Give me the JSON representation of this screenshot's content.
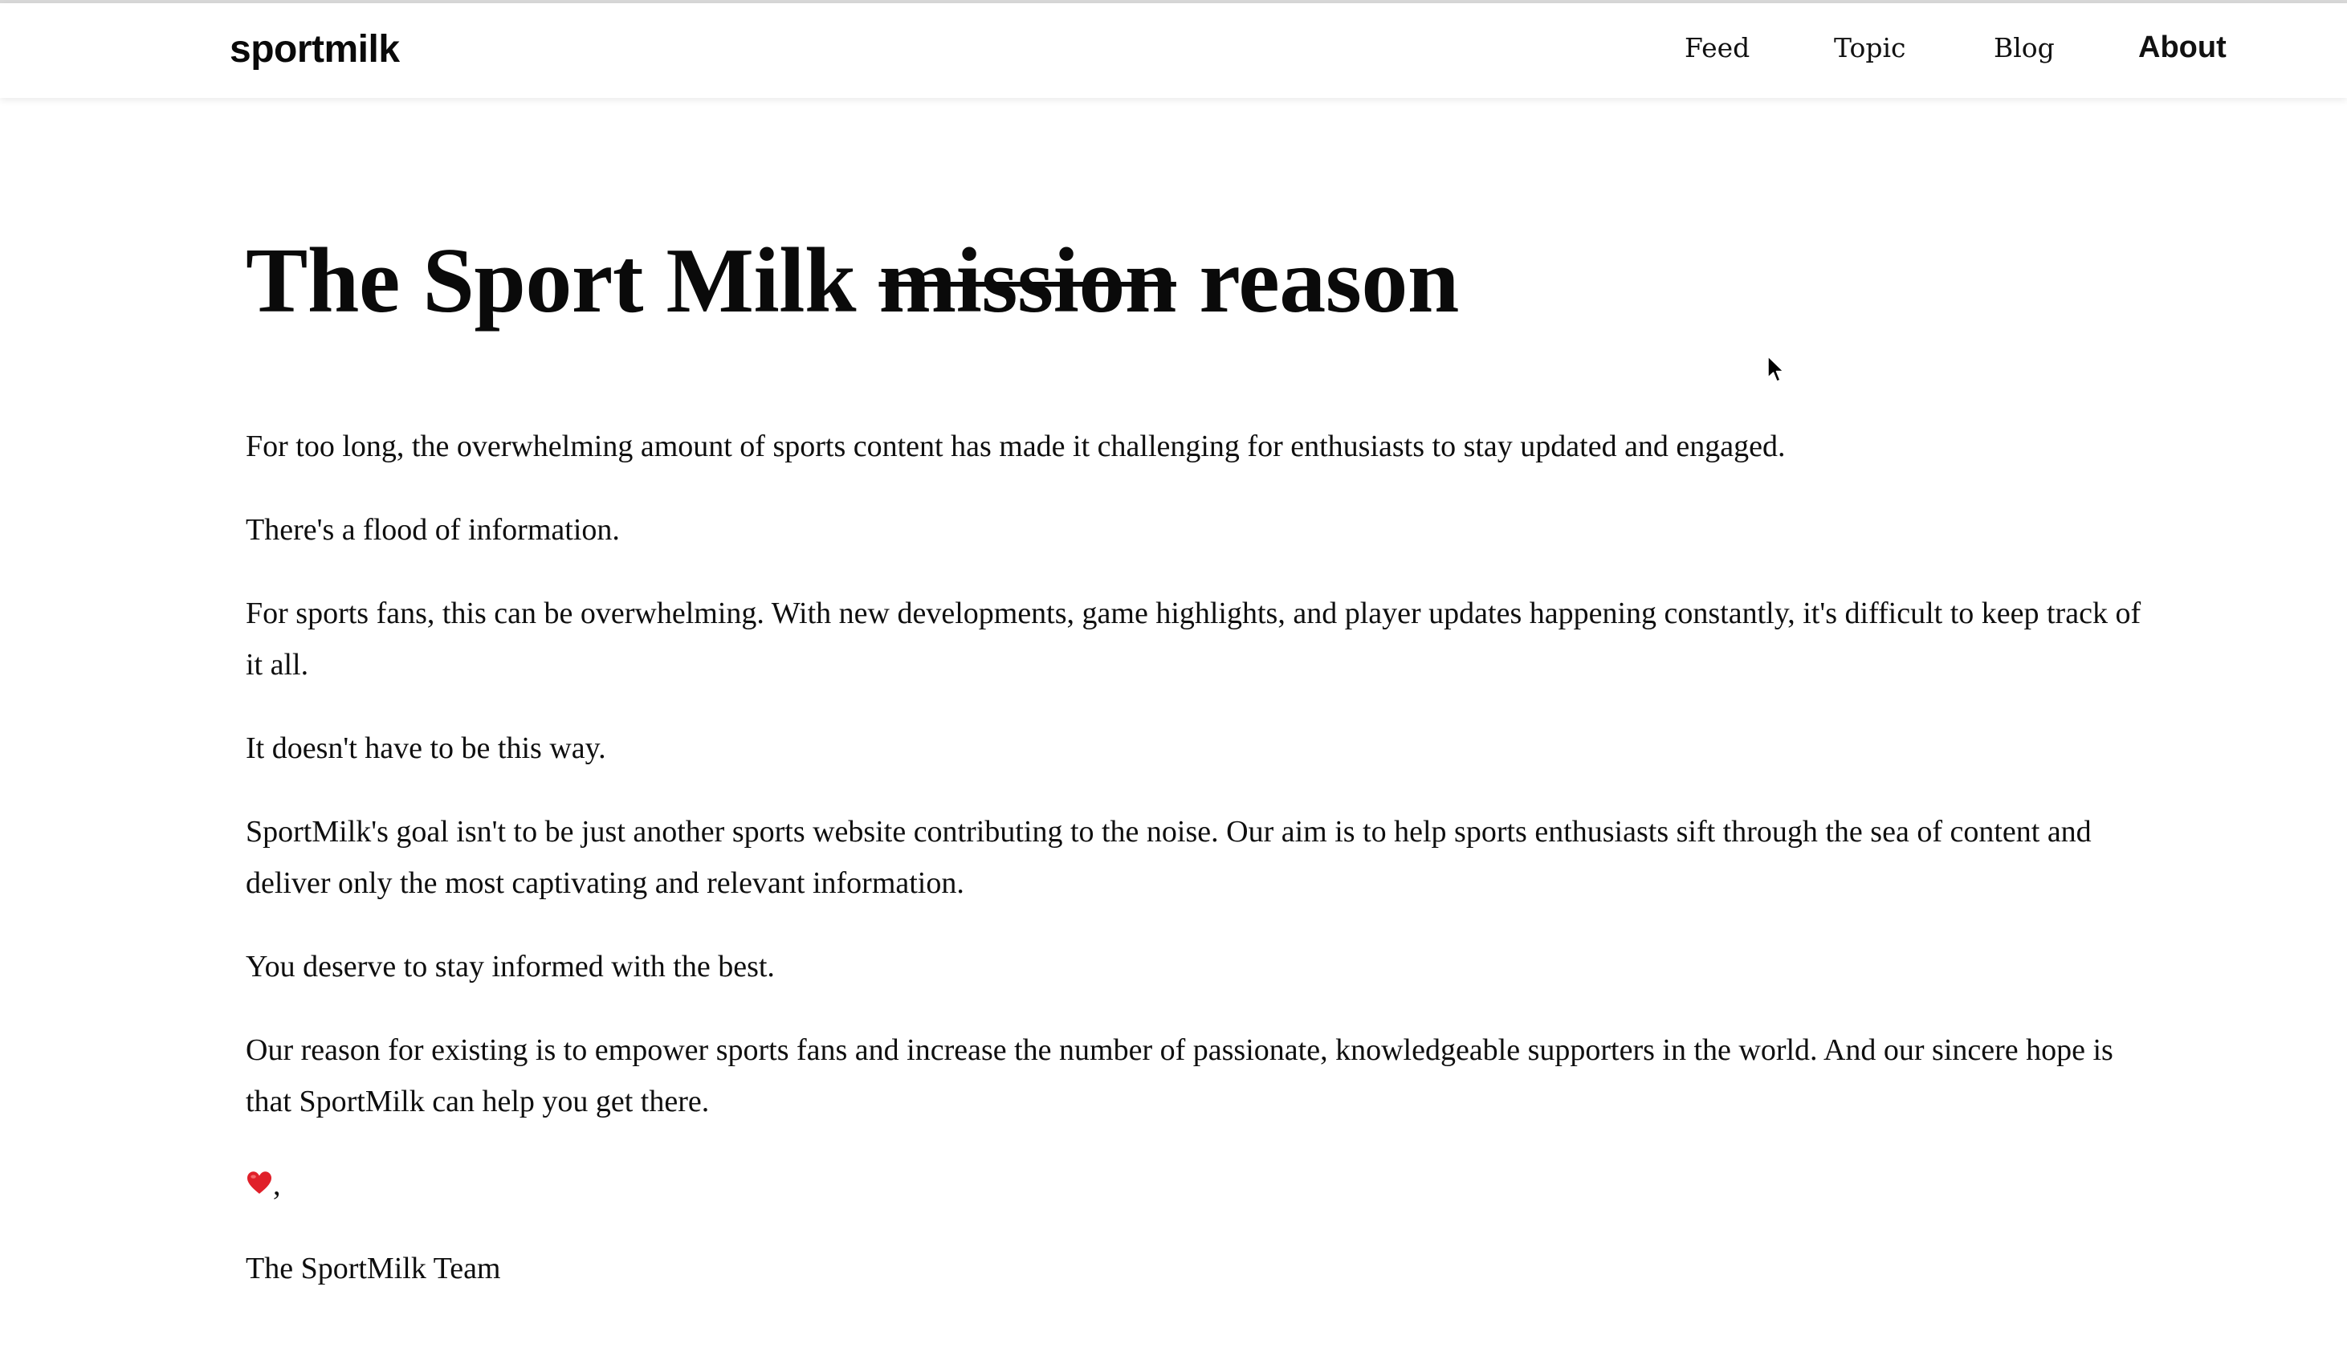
{
  "brand": {
    "logo": "sportmilk"
  },
  "nav": {
    "items": [
      {
        "label": "Feed"
      },
      {
        "label": "Topic"
      },
      {
        "label": "Blog"
      },
      {
        "label": "About"
      }
    ],
    "active": "About"
  },
  "title": {
    "prefix": "The Sport Milk",
    "struck": "mission",
    "suffix": "reason"
  },
  "paragraphs": [
    "For too long, the overwhelming amount of sports content has made it challenging for enthusiasts to stay updated and engaged.",
    "There's a flood of information.",
    "For sports fans, this can be overwhelming. With new developments, game highlights, and player updates happening constantly, it's difficult to keep track of it all.",
    "It doesn't have to be this way.",
    "SportMilk's goal isn't to be just another sports website contributing to the noise. Our aim is to help sports enthusiasts sift through the sea of content and deliver only the most captivating and relevant information.",
    "You deserve to stay informed with the best.",
    "Our reason for existing is to empower sports fans and increase the number of passionate, knowledgeable supporters in the world. And our sincere hope is that SportMilk can help you get there."
  ],
  "signoff": {
    "icon": "heart-icon",
    "punctuation": ",",
    "signature": "The SportMilk Team"
  },
  "colors": {
    "heart": "#e0202a",
    "text": "#0c0c0c",
    "background": "#ffffff"
  }
}
